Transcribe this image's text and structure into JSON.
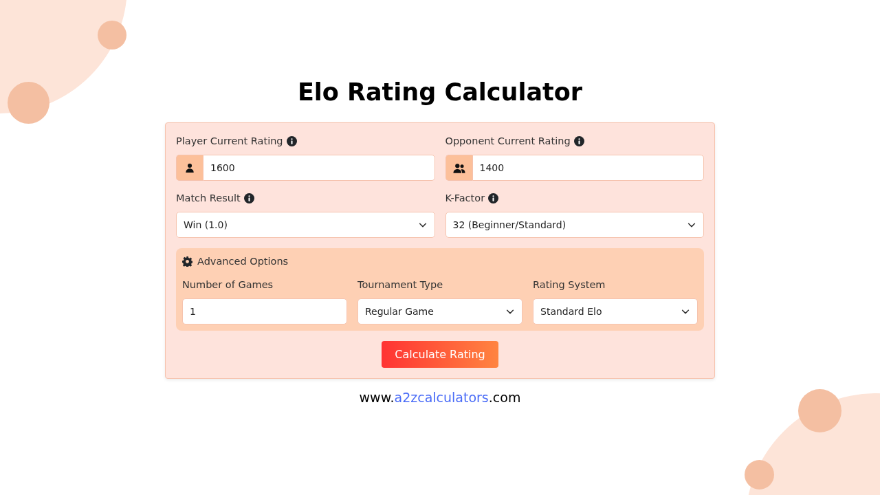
{
  "title": "Elo Rating Calculator",
  "fields": [
    {
      "label": "Player Current Rating",
      "info": true,
      "kind": "input",
      "value": "1600"
    },
    {
      "label": "Opponent Current Rating",
      "info": true,
      "kind": "input",
      "value": "1400"
    },
    {
      "label": "Match Result",
      "info": true,
      "kind": "select",
      "value": "Win (1.0)"
    },
    {
      "label": "K-Factor",
      "info": true,
      "kind": "select",
      "value": "32 (Beginner/Standard)"
    }
  ],
  "advanced": {
    "title": "Advanced Options",
    "fields": [
      {
        "label": "Number of Games",
        "kind": "input",
        "value": "1"
      },
      {
        "label": "Tournament Type",
        "kind": "select",
        "value": "Regular Game"
      },
      {
        "label": "Rating System",
        "kind": "select",
        "value": "Standard Elo"
      }
    ]
  },
  "button": "Calculate Rating",
  "footer": [
    {
      "text": "www.",
      "highlight": false
    },
    {
      "text": "a2zcalculators",
      "highlight": true
    },
    {
      "text": ".com",
      "highlight": false
    }
  ]
}
